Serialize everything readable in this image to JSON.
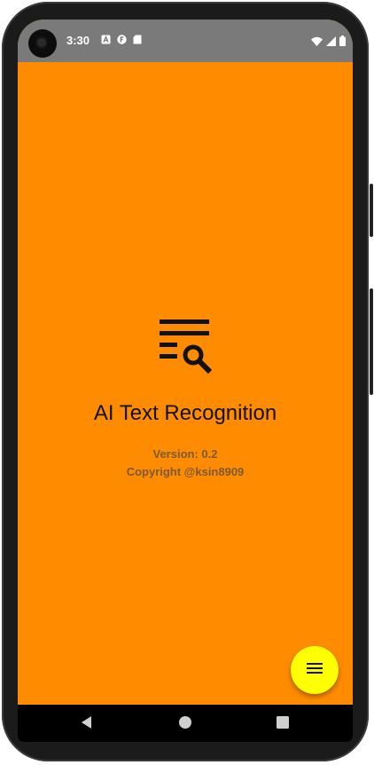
{
  "status_bar": {
    "time": "3:30",
    "icons": [
      "a-icon",
      "f-icon",
      "sd-card-icon"
    ],
    "right_icons": [
      "wifi-icon",
      "signal-icon",
      "battery-icon"
    ],
    "background": "#7a7a7a"
  },
  "app": {
    "background": "#ff8c00",
    "icon": "text-search-icon",
    "title": "AI Text Recognition",
    "version": "Version: 0.2",
    "copyright": "Copyright @ksin8909"
  },
  "fab": {
    "icon": "menu-icon",
    "color": "#ffff00"
  },
  "nav_bar": {
    "buttons": [
      "back-icon",
      "home-icon",
      "recent-apps-icon"
    ]
  }
}
